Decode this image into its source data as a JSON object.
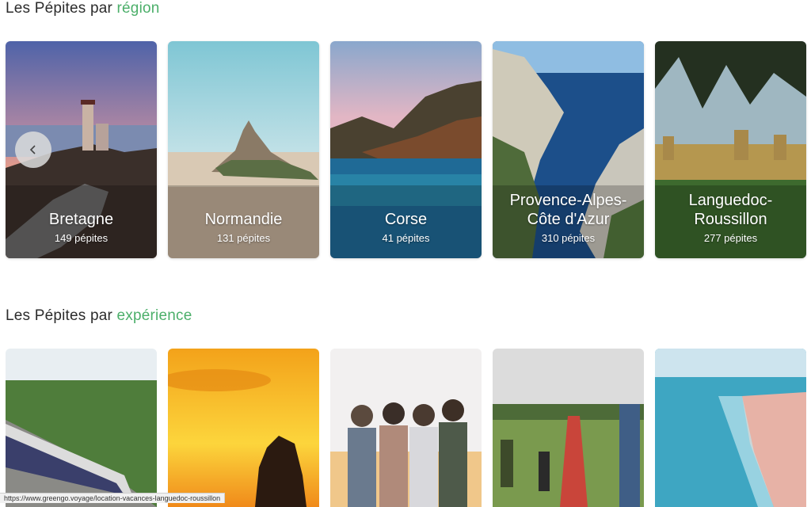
{
  "sections": {
    "region": {
      "title_prefix": "Les Pépites par ",
      "title_accent": "région"
    },
    "experience": {
      "title_prefix": "Les Pépites par ",
      "title_accent": "expérience"
    }
  },
  "regions": [
    {
      "name": "Bretagne",
      "count": "149 pépites"
    },
    {
      "name": "Normandie",
      "count": "131 pépites"
    },
    {
      "name": "Corse",
      "count": "41 pépites"
    },
    {
      "name": "Provence-Alpes-Côte d'Azur",
      "count": "310 pépites"
    },
    {
      "name": "Languedoc-Roussillon",
      "count": "277 pépites"
    }
  ],
  "carousel": {
    "prev_icon": "chevron-left-icon"
  },
  "status_bar": {
    "url": "https://www.greengo.voyage/location-vacances-languedoc-roussillon"
  },
  "colors": {
    "accent": "#4caf6a",
    "text": "#2c2c2c"
  }
}
